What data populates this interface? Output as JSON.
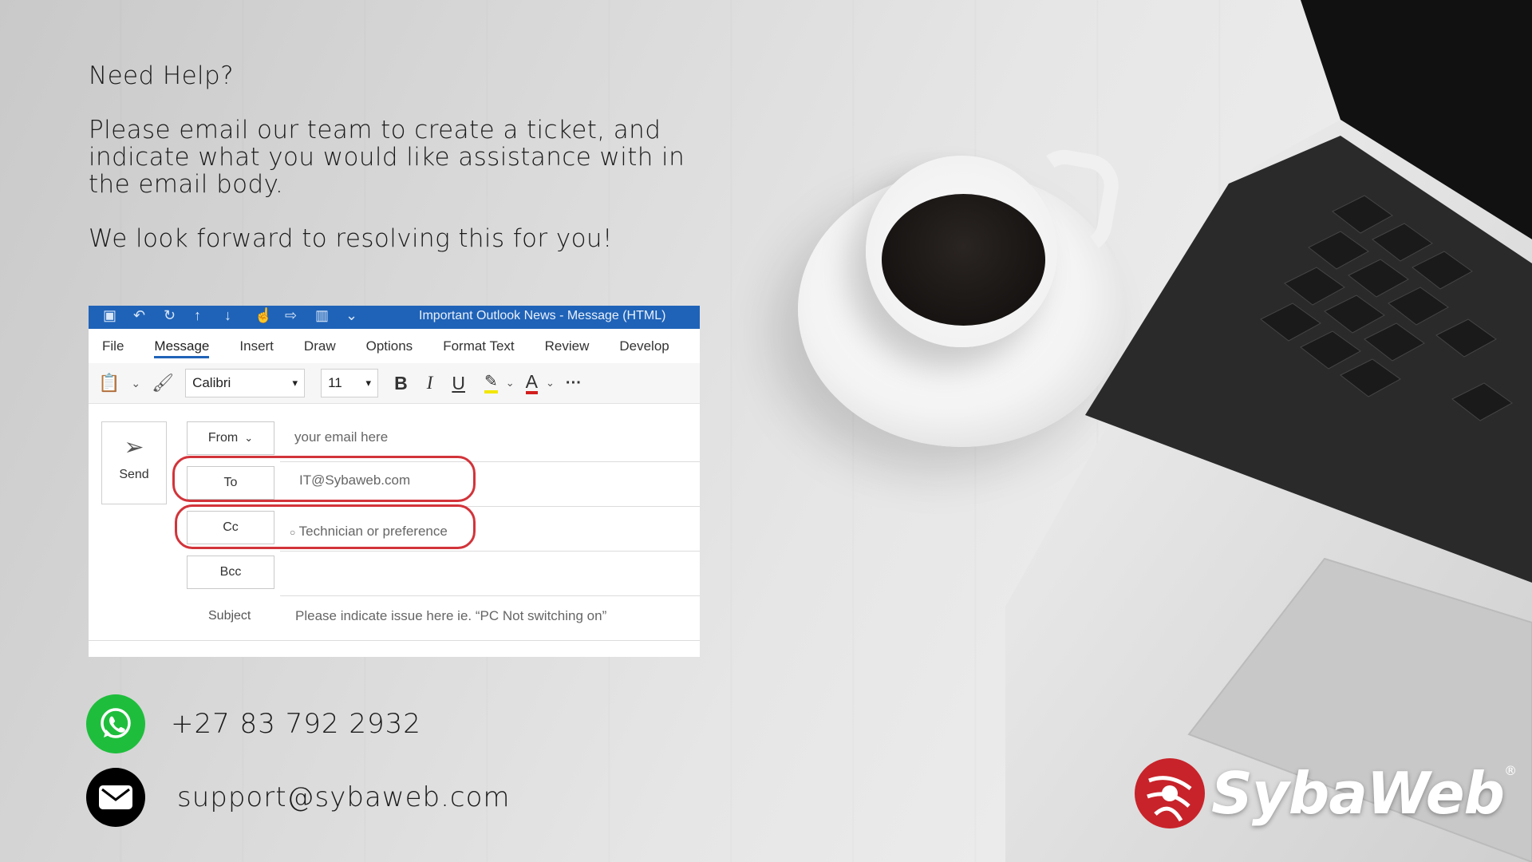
{
  "help": {
    "heading": "Need Help?",
    "body": "Please email our team to create a ticket, and indicate what you would like assistance with in the email body.",
    "closing": "We look forward to resolving this for you!"
  },
  "outlook": {
    "window_title": "Important Outlook News  -  Message (HTML)",
    "menu": [
      "File",
      "Message",
      "Insert",
      "Draw",
      "Options",
      "Format Text",
      "Review",
      "Develop"
    ],
    "font_name": "Calibri",
    "font_size": "11",
    "format_bold": "B",
    "format_italic": "I",
    "format_underline": "U",
    "font_color": "A",
    "more": "···",
    "send_label": "Send",
    "from_label": "From",
    "from_value": "your email here",
    "to_label": "To",
    "to_value": "IT@Sybaweb.com",
    "cc_label": "Cc",
    "cc_value": "Technician or preference",
    "bcc_label": "Bcc",
    "subject_label": "Subject",
    "subject_value": "Please indicate issue here ie. “PC Not switching on”",
    "accent_color": "#1f63b8",
    "highlight_ring_color": "#d2343a"
  },
  "contacts": {
    "phone": "+27 83 792 2932",
    "phone_icon": "whatsapp-icon",
    "phone_icon_color": "#1ebe3c",
    "email": "support@sybaweb.com",
    "email_icon": "envelope-icon"
  },
  "logo": {
    "text": "SybaWeb",
    "registered": "®",
    "color": "#c8232a"
  }
}
